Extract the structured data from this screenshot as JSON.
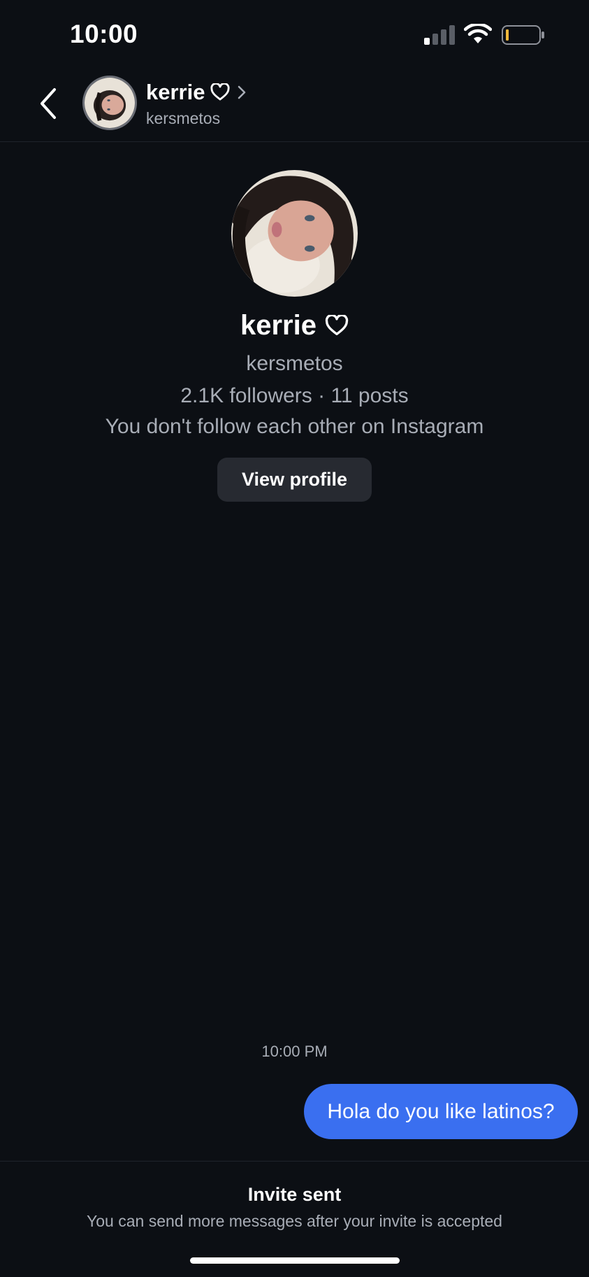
{
  "status_bar": {
    "time": "10:00",
    "icons": [
      "cellular-signal-icon",
      "wifi-icon",
      "battery-icon"
    ]
  },
  "header": {
    "back_icon": "chevron-left-icon",
    "name": "kerrie",
    "name_icon": "heart-outline-icon",
    "chevron_icon": "chevron-right-icon",
    "username": "kersmetos"
  },
  "profile": {
    "name": "kerrie",
    "name_icon": "heart-outline-icon",
    "username": "kersmetos",
    "stats": "2.1K followers · 11 posts",
    "relation": "You don't follow each other on Instagram",
    "view_profile_label": "View profile"
  },
  "conversation": {
    "timestamp": "10:00 PM",
    "messages": [
      {
        "text": "Hola do you like latinos?",
        "direction": "outgoing"
      }
    ]
  },
  "footer": {
    "title": "Invite sent",
    "subtitle": "You can send more messages after your invite is accepted"
  },
  "colors": {
    "background": "#0c0f14",
    "bubble": "#3a6ff0",
    "secondary_text": "#a8adb6",
    "button": "#272a31"
  }
}
